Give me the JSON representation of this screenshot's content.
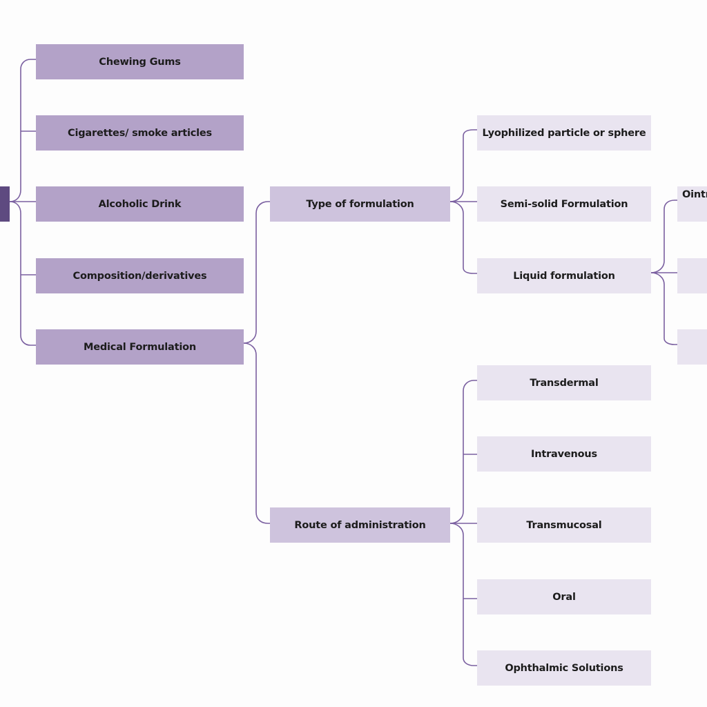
{
  "diagram": {
    "root": {
      "label": ""
    },
    "categories": [
      {
        "label": "Chewing Gums"
      },
      {
        "label": "Cigarettes/ smoke articles"
      },
      {
        "label": "Alcoholic Drink"
      },
      {
        "label": "Composition/derivatives"
      },
      {
        "label": "Medical Formulation"
      }
    ],
    "medical_formulation": {
      "type_of_formulation": {
        "label": "Type of formulation",
        "children": [
          {
            "label": "Lyophilized particle or sphere"
          },
          {
            "label": "Semi-solid Formulation"
          },
          {
            "label": "Liquid formulation"
          }
        ]
      },
      "route_of_administration": {
        "label": "Route of administration",
        "children": [
          {
            "label": "Transdermal"
          },
          {
            "label": "Intravenous"
          },
          {
            "label": "Transmucosal"
          },
          {
            "label": "Oral"
          },
          {
            "label": "Ophthalmic Solutions"
          }
        ]
      }
    },
    "liquid_formulation_children": [
      {
        "label": "Ointr"
      },
      {
        "label": ""
      },
      {
        "label": ""
      }
    ]
  },
  "colors": {
    "root": "#5e4a80",
    "level1": "#b3a2c8",
    "level2": "#cec3dd",
    "level3": "#e9e4f0",
    "connector": "#7a5fa0"
  }
}
